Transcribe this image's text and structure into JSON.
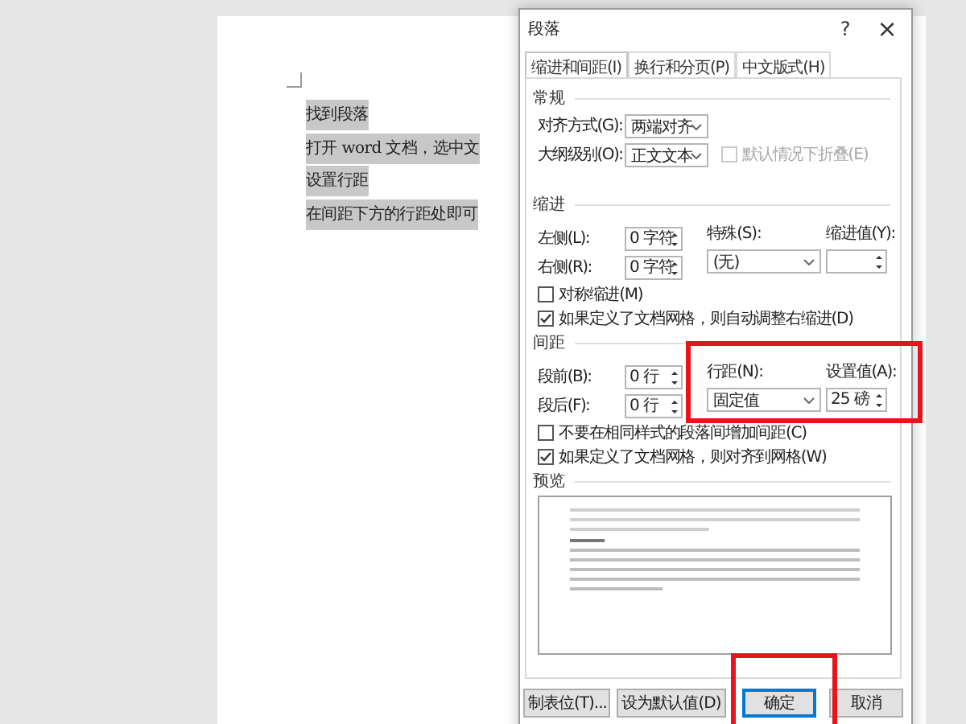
{
  "document": {
    "lines": [
      {
        "text": "找到段落"
      },
      {
        "text": "打开 word 文档，选中文"
      },
      {
        "text": "设置行距"
      },
      {
        "text": "在间距下方的行距处即可"
      }
    ]
  },
  "dialog": {
    "title": "段落",
    "help": "?",
    "close": "×",
    "tabs": [
      {
        "label": "缩进和间距(I)",
        "selected": true
      },
      {
        "label": "换行和分页(P)",
        "selected": false
      },
      {
        "label": "中文版式(H)",
        "selected": false
      }
    ],
    "general": {
      "heading": "常规",
      "alignment": {
        "label": "对齐方式(G):",
        "value": "两端对齐"
      },
      "outline_level": {
        "label": "大纲级别(O):",
        "value": "正文文本"
      },
      "collapse": {
        "label": "默认情况下折叠(E)",
        "checked": false,
        "disabled": true
      }
    },
    "indent": {
      "heading": "缩进",
      "left": {
        "label": "左侧(L):",
        "value": "0 字符"
      },
      "right": {
        "label": "右侧(R):",
        "value": "0 字符"
      },
      "special": {
        "label": "特殊(S):",
        "value": "(无)"
      },
      "by": {
        "label": "缩进值(Y):"
      },
      "options": [
        {
          "label": "对称缩进(M)",
          "checked": false,
          "disabled": false
        },
        {
          "label": "如果定义了文档网格，则自动调整右缩进(D)",
          "checked": true,
          "disabled": false
        }
      ]
    },
    "spacing": {
      "heading": "间距",
      "before": {
        "label": "段前(B):",
        "value": "0 行"
      },
      "after": {
        "label": "段后(F):",
        "value": "0 行"
      },
      "line_spacing": {
        "label": "行距(N):",
        "value": "固定值"
      },
      "at": {
        "label": "设置值(A):",
        "value": "25 磅"
      },
      "options": [
        {
          "label": "不要在相同样式的段落间增加间距(C)",
          "checked": false,
          "disabled": false
        },
        {
          "label": "如果定义了文档网格，则对齐到网格(W)",
          "checked": true,
          "disabled": false
        }
      ]
    },
    "preview": {
      "heading": "预览"
    },
    "buttons": [
      {
        "label": "制表位(T)...",
        "default": false
      },
      {
        "label": "设为默认值(D)",
        "default": false
      },
      {
        "label": "确定",
        "default": true
      },
      {
        "label": "取消",
        "default": false
      }
    ]
  }
}
